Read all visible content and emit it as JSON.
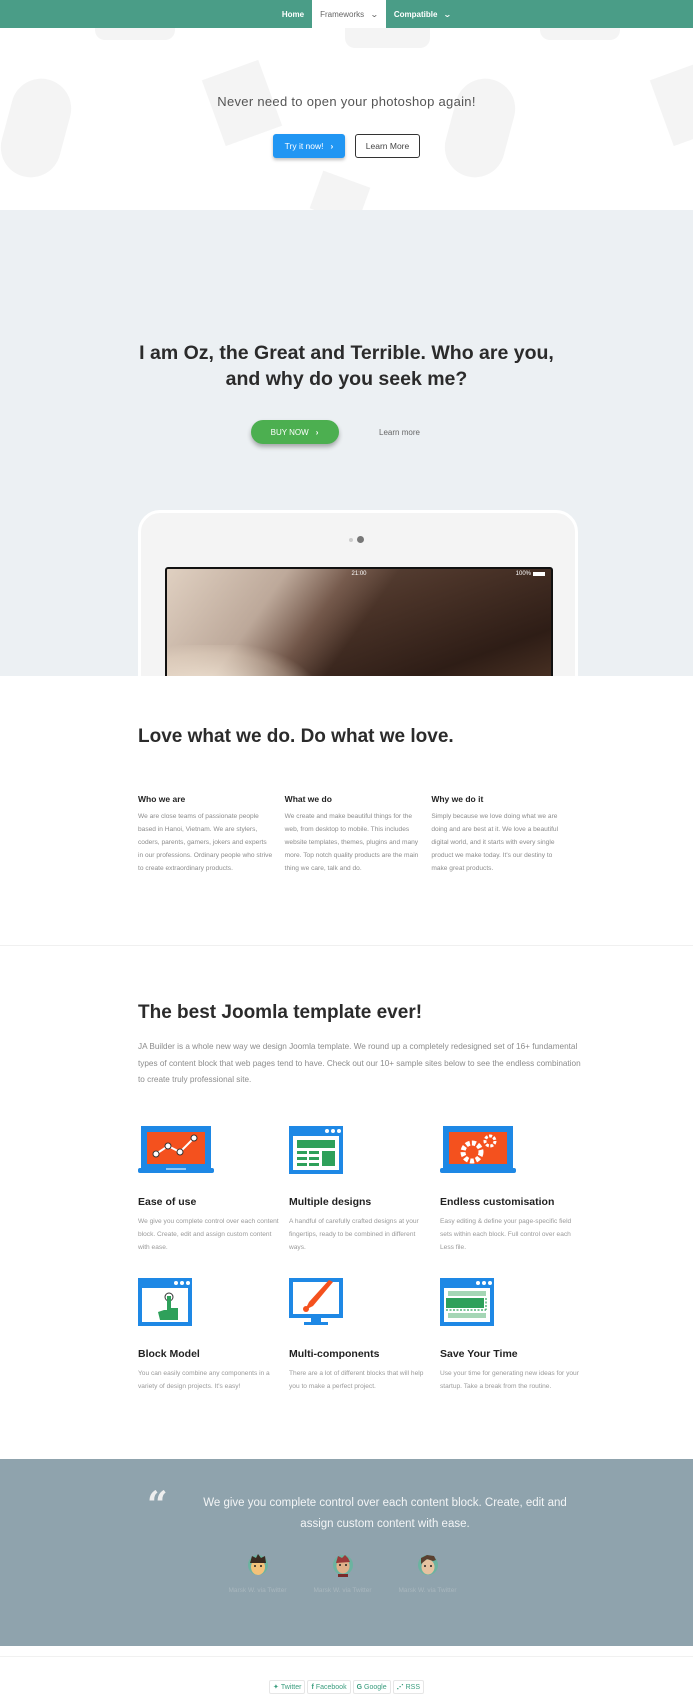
{
  "nav": {
    "items": [
      {
        "label": "Home",
        "active": false,
        "has_dropdown": false
      },
      {
        "label": "Frameworks",
        "active": true,
        "has_dropdown": true
      },
      {
        "label": "Compatible",
        "active": false,
        "has_dropdown": true
      }
    ],
    "chevron_icon": "chevron-down-icon"
  },
  "hero": {
    "tagline": "Never need to open your photoshop again!",
    "primary_button": "Try it now!",
    "primary_button_icon": "›",
    "secondary_button": "Learn More"
  },
  "showcase": {
    "headline_line1": "I am Oz, the Great and Terrible. Who are you,",
    "headline_line2": "and why do you seek me?",
    "buy_button": "BUY NOW",
    "buy_button_icon": "›",
    "learn_more": "Learn more",
    "device": {
      "status_time": "21:00",
      "status_battery": "100%"
    }
  },
  "about": {
    "title": "Love what we do. Do what we love.",
    "columns": [
      {
        "heading": "Who we are",
        "text": "We are close teams of passionate people based in Hanoi, Vietnam. We are stylers, coders, parents, gamers, jokers and experts in our professions. Ordinary people who strive to create extraordinary products."
      },
      {
        "heading": "What we do",
        "text": "We create and make beautiful things for the web, from desktop to mobile. This includes website templates, themes, plugins and many more. Top notch quality products are the main thing we care, talk and do."
      },
      {
        "heading": "Why we do it",
        "text": "Simply because we love doing what we are doing and are best at it. We love a beautiful digital world, and it starts with every single product we make today. It's our destiny to make great products."
      }
    ]
  },
  "features": {
    "title": "The best Joomla template ever!",
    "intro": "JA Builder is a whole new way we design Joomla template. We round up a completely redesigned set of 16+ fundamental types of content block that web pages tend to have. Check out our 10+ sample sites below to see the endless combination to create truly professional site.",
    "items": [
      {
        "icon": "laptop-chart-icon",
        "title": "Ease of use",
        "text": "We give you complete control over each content block. Create, edit and assign custom content with ease."
      },
      {
        "icon": "browser-layout-icon",
        "title": "Multiple designs",
        "text": "A handful of carefully crafted designs at your fingertips, ready to be combined in different ways."
      },
      {
        "icon": "laptop-gears-icon",
        "title": "Endless customisation",
        "text": "Easy editing & define your page-specific field sets within each block. Full control over each Less file."
      },
      {
        "icon": "browser-touch-icon",
        "title": "Block Model",
        "text": "You can easily combine any components in a variety of design projects. It's easy!"
      },
      {
        "icon": "monitor-brush-icon",
        "title": "Multi-components",
        "text": "There are a lot of different blocks that will help you to make a perfect project."
      },
      {
        "icon": "browser-blocks-icon",
        "title": "Save Your Time",
        "text": "Use your time for generating new ideas for your startup. Take a break from the routine."
      }
    ]
  },
  "testimonial": {
    "quote": "We give you complete control over each content block. Create, edit and assign custom content with ease.",
    "authors": [
      {
        "name": "Marsk W. via Twitter"
      },
      {
        "name": "Marsk W. via Twitter"
      },
      {
        "name": "Marsk W. via Twitter"
      }
    ]
  },
  "footer": {
    "social": [
      {
        "icon": "twitter-icon",
        "glyph": "🐦",
        "label": "Twitter"
      },
      {
        "icon": "facebook-icon",
        "glyph": "f",
        "label": "Facebook"
      },
      {
        "icon": "google-icon",
        "glyph": "G",
        "label": "Google"
      },
      {
        "icon": "rss-icon",
        "glyph": "◝",
        "label": "RSS"
      }
    ]
  },
  "colors": {
    "nav_bg": "#4a9d87",
    "primary_blue": "#2196f3",
    "buy_green": "#4caf50",
    "showcase_bg": "#ecf0f3",
    "testimonial_bg": "#8fa3ad",
    "icon_blue": "#1e88e5",
    "icon_orange": "#f4511e",
    "icon_green": "#2ea05a"
  }
}
